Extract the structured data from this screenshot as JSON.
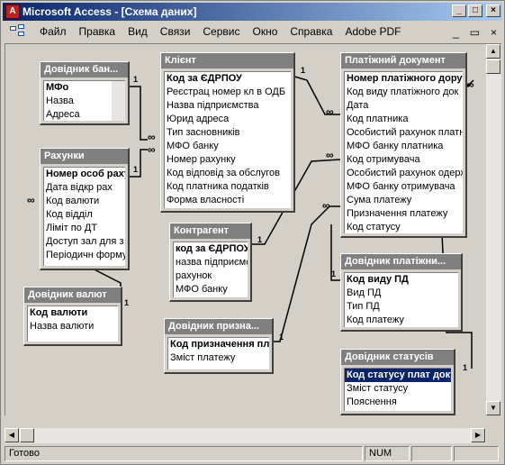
{
  "window": {
    "title": "Microsoft Access - [Схема даних]",
    "app_icon": "access-key-icon",
    "controls": [
      "_",
      "□",
      "×"
    ]
  },
  "menubar": {
    "items": [
      "Файл",
      "Правка",
      "Вид",
      "Связи",
      "Сервис",
      "Окно",
      "Справка",
      "Adobe PDF"
    ],
    "mdi_controls": [
      "_",
      "▭",
      "×"
    ]
  },
  "tables": {
    "dovidnyk_bankiv": {
      "title": "Довідник бан...",
      "fields": [
        "МФо",
        "Назва",
        "Адреса"
      ]
    },
    "rakhunky": {
      "title": "Рахунки",
      "fields": [
        "Номер особ рахун",
        "Дата відкр рах",
        "Код валюти",
        "Код відділ",
        "Ліміт по ДТ",
        "Доступ зал для з",
        "Періодичн форму"
      ]
    },
    "dovidnyk_valyut": {
      "title": "Довідник валют",
      "fields": [
        "Код валюти",
        "Назва валюти"
      ]
    },
    "klient": {
      "title": "Клієнт",
      "fields": [
        "Код за ЄДРПОУ",
        "Реєстрац номер кл в ОДБ",
        "Назва підприємства",
        "Юрид адреса",
        "Тип засновників",
        "МФО банку",
        "Номер рахунку",
        "Код відповід за обслугов",
        "Код платника податків",
        "Форма власності"
      ]
    },
    "kontragent": {
      "title": "Контрагент",
      "fields": [
        "код за ЄДРПОУ",
        "назва підприємс",
        "рахунок",
        "МФО банку"
      ]
    },
    "dovidnyk_pryzn": {
      "title": "Довідник призна...",
      "fields": [
        "Код призначення плат",
        "Зміст платежу"
      ]
    },
    "platizhnyi_dokument": {
      "title": "Платіжний документ",
      "fields": [
        "Номер платіжного доручен",
        "Код виду платіжного док",
        "Дата",
        "Код  платника",
        "Особистий рахунок платн",
        "МФО банку платника",
        "Код отримувача",
        "Особистий рахунок одерж",
        "МФО банку отримувача",
        "Сума платежу",
        "Призначення платежу",
        "Код статусу"
      ]
    },
    "dovidnyk_platizhnykh": {
      "title": "Довідник платіжни...",
      "fields": [
        "Код виду ПД",
        "Вид ПД",
        "Тип ПД",
        "Код платежу"
      ]
    },
    "dovidnyk_statusiv": {
      "title": "Довідник статусів",
      "fields": [
        "Код статусу плат доку",
        "Зміст статусу",
        "Пояснення"
      ]
    }
  },
  "relation_marks": {
    "one": "1",
    "many": "∞"
  },
  "statusbar": {
    "text": "Готово",
    "num": "NUM"
  }
}
